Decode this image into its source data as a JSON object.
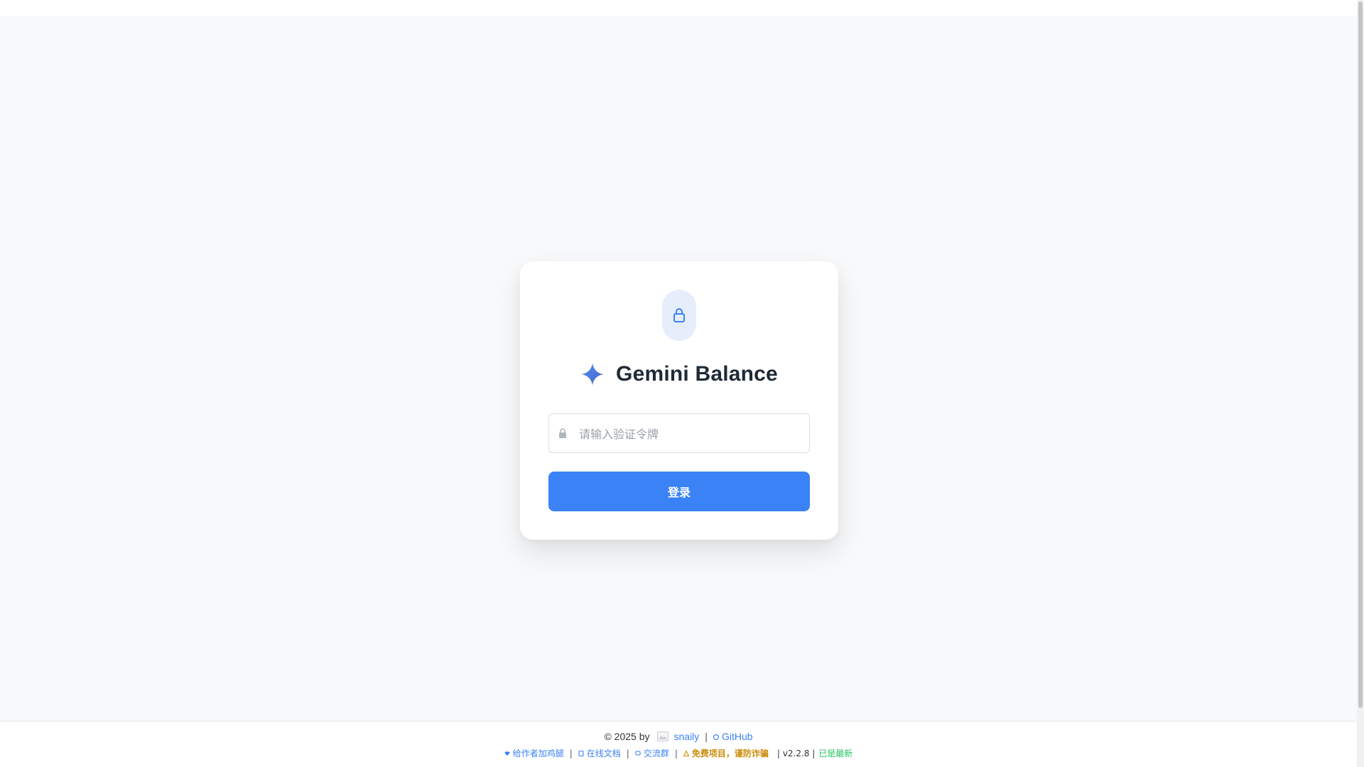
{
  "app": {
    "title": "Gemini Balance"
  },
  "login": {
    "token_placeholder": "请输入验证令牌",
    "token_value": "",
    "submit_label": "登录"
  },
  "footer": {
    "copyright": "© 2025 by",
    "author": "snaily",
    "github_label": "GitHub",
    "links": {
      "donate": "给作者加鸡腿",
      "docs": "在线文档",
      "group": "交流群",
      "warning": "免费项目，谨防诈骗"
    },
    "version": "| v2.2.8 |",
    "update_status": "已是最新"
  },
  "icons": {
    "lock": "lock-icon",
    "spark": "sparkle-icon",
    "key": "key-icon",
    "github": "github-icon"
  },
  "colors": {
    "accent": "#3b82f6",
    "warning": "#ca8a04",
    "success": "#22c55e",
    "title": "#1f2a37"
  }
}
